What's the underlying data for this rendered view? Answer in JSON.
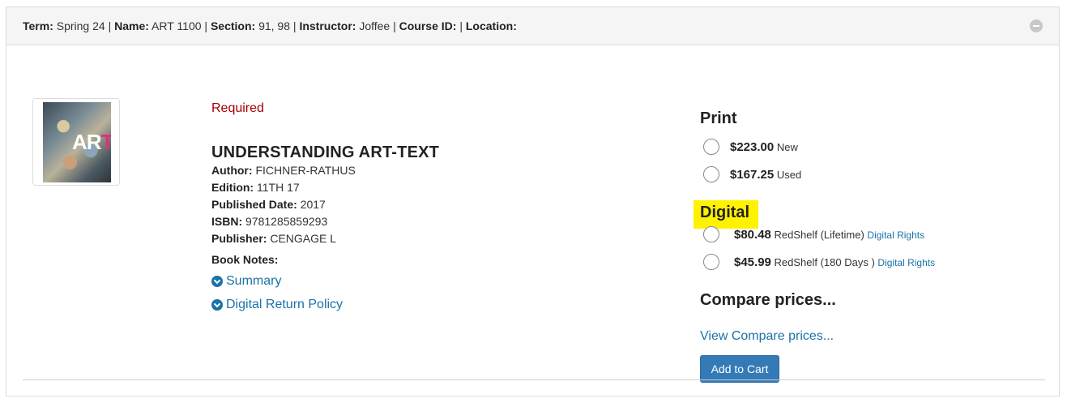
{
  "course_header": {
    "term_label": "Term:",
    "term_value": "Spring 24",
    "name_label": "Name:",
    "name_value": "ART 1100",
    "section_label": "Section:",
    "section_value": "91, 98",
    "instructor_label": "Instructor:",
    "instructor_value": "Joffee",
    "course_id_label": "Course ID:",
    "course_id_value": "",
    "location_label": "Location:",
    "location_value": "",
    "collapse_icon": "minus-circle-icon"
  },
  "book": {
    "status": "Required",
    "title": "UNDERSTANDING ART-TEXT",
    "cover_letters_main": "AR",
    "cover_letters_accent": "T",
    "author_label": "Author:",
    "author": "FICHNER-RATHUS",
    "edition_label": "Edition:",
    "edition": "11TH 17",
    "published_label": "Published Date:",
    "published": "2017",
    "isbn_label": "ISBN:",
    "isbn": "9781285859293",
    "publisher_label": "Publisher:",
    "publisher": "CENGAGE L",
    "notes_label": "Book Notes:",
    "summary_link": "Summary",
    "return_policy_link": "Digital Return Policy"
  },
  "pricing": {
    "print_heading": "Print",
    "print_options": [
      {
        "price": "$223.00",
        "condition": "New"
      },
      {
        "price": "$167.25",
        "condition": "Used"
      }
    ],
    "digital_heading": "Digital",
    "digital_options": [
      {
        "price": "$80.48",
        "detail": "RedShelf (Lifetime)",
        "link": "Digital Rights"
      },
      {
        "price": "$45.99",
        "detail": "RedShelf (180 Days )",
        "link": "Digital Rights"
      }
    ],
    "compare_heading": "Compare prices...",
    "compare_link": "View Compare prices...",
    "add_to_cart": "Add to Cart"
  },
  "colors": {
    "link": "#1a73a8",
    "required": "#a50000",
    "highlight": "#fff200",
    "button": "#337ab7"
  }
}
